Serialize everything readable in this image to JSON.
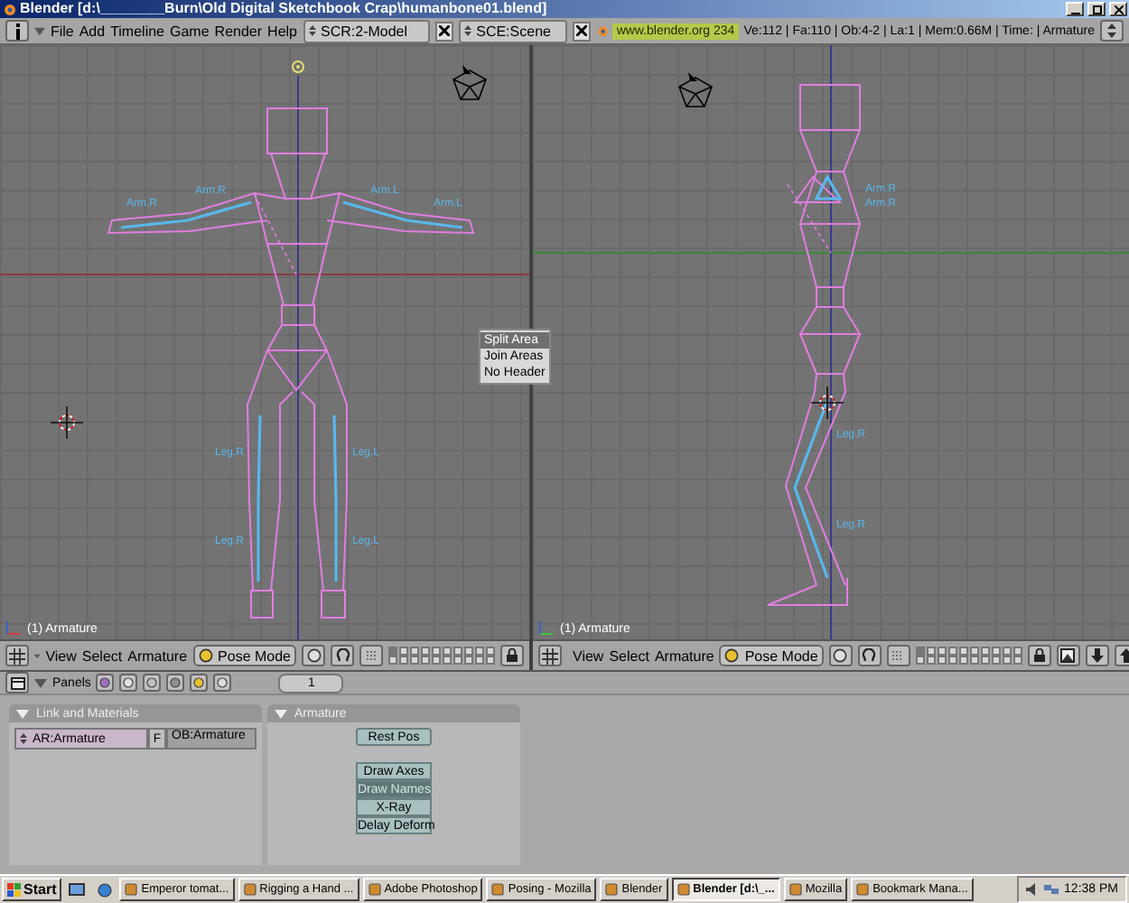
{
  "window": {
    "title": "Blender [d:\\________Burn\\Old Digital Sketchbook Crap\\humanbone01.blend]"
  },
  "menu": [
    "File",
    "Add",
    "Timeline",
    "Game",
    "Render",
    "Help"
  ],
  "screen_field": "SCR:2-Model",
  "scene_field": "SCE:Scene",
  "info": {
    "site": "www.blender.org 234",
    "stats": "Ve:112 | Fa:110 | Ob:4-2 | La:1 | Mem:0.66M | Time: | Armature"
  },
  "viewports": [
    {
      "kind": "front",
      "overlay": "(1) Armature",
      "bone_labels": [
        "Arm.R",
        "Arm.R",
        "Arm.L",
        "Arm.L",
        "Leg.R",
        "Leg.L",
        "Leg.R",
        "Leg.L"
      ],
      "header": {
        "menus": [
          "View",
          "Select",
          "Armature"
        ],
        "mode": "Pose Mode"
      }
    },
    {
      "kind": "side",
      "overlay": "(1) Armature",
      "bone_labels": [
        "Arm.R",
        "Arm.R",
        "Leg.R",
        "Leg.R"
      ],
      "header": {
        "menus": [
          "View",
          "Select",
          "Armature"
        ],
        "mode": "Pose Mode"
      }
    }
  ],
  "context_menu": [
    {
      "label": "Split Area",
      "selected": true
    },
    {
      "label": "Join Areas",
      "selected": false
    },
    {
      "label": "No Header",
      "selected": false
    }
  ],
  "buttons_header": {
    "label": "Panels",
    "frame": "1"
  },
  "panels": [
    {
      "kind": "link",
      "title": "Link and Materials",
      "data_block": "AR:Armature",
      "fake_user": "F",
      "object": "OB:Armature"
    },
    {
      "kind": "armature",
      "title": "Armature",
      "rest_button": "Rest Pos",
      "toggles": [
        {
          "label": "Draw Axes",
          "on": false
        },
        {
          "label": "Draw Names",
          "on": true
        },
        {
          "label": "X-Ray",
          "on": false
        },
        {
          "label": "Delay Deform",
          "on": false
        }
      ]
    }
  ],
  "taskbar": {
    "start": "Start",
    "tasks": [
      {
        "label": "Emperor tomat...",
        "selected": false
      },
      {
        "label": "Rigging a Hand ...",
        "selected": false
      },
      {
        "label": "Adobe Photoshop",
        "selected": false
      },
      {
        "label": "Posing - Mozilla",
        "selected": false
      },
      {
        "label": "Blender",
        "selected": false
      },
      {
        "label": "Blender [d:\\_...",
        "selected": true
      },
      {
        "label": "Mozilla",
        "selected": false
      },
      {
        "label": "Bookmark Mana...",
        "selected": false
      }
    ],
    "clock": "12:38 PM"
  }
}
